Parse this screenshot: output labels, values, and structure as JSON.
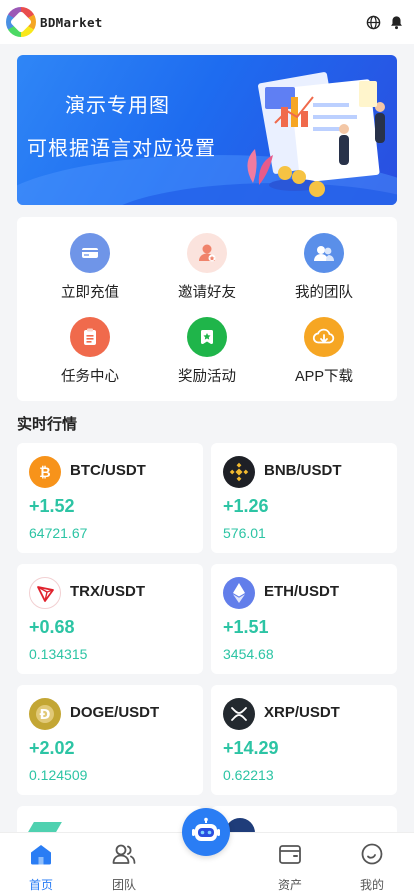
{
  "header": {
    "brand": "BDMarket",
    "icons": [
      "globe-icon",
      "bell-icon"
    ]
  },
  "banner": {
    "line1": "演示专用图",
    "line2": "可根据语言对应设置"
  },
  "shortcuts": [
    {
      "label": "立即充值",
      "icon": "recharge-icon",
      "color": "#6f95e8"
    },
    {
      "label": "邀请好友",
      "icon": "invite-icon",
      "color": "#f0836b"
    },
    {
      "label": "我的团队",
      "icon": "team-icon",
      "color": "#5a8fe9"
    },
    {
      "label": "任务中心",
      "icon": "task-icon",
      "color": "#f06a4c"
    },
    {
      "label": "奖励活动",
      "icon": "reward-icon",
      "color": "#1fb54a"
    },
    {
      "label": "APP下载",
      "icon": "download-icon",
      "color": "#f6a623"
    }
  ],
  "market": {
    "title": "实时行情",
    "items": [
      {
        "pair": "BTC/USDT",
        "change": "+1.52",
        "price": "64721.67",
        "icon": "btc-icon",
        "color": "#f7931a"
      },
      {
        "pair": "BNB/USDT",
        "change": "+1.26",
        "price": "576.01",
        "icon": "bnb-icon",
        "color": "#f3ba2f"
      },
      {
        "pair": "TRX/USDT",
        "change": "+0.68",
        "price": "0.134315",
        "icon": "trx-icon",
        "color": "#e0222d"
      },
      {
        "pair": "ETH/USDT",
        "change": "+1.51",
        "price": "3454.68",
        "icon": "eth-icon",
        "color": "#627eea"
      },
      {
        "pair": "DOGE/USDT",
        "change": "+2.02",
        "price": "0.124509",
        "icon": "doge-icon",
        "color": "#c3a634"
      },
      {
        "pair": "XRP/USDT",
        "change": "+14.29",
        "price": "0.62213",
        "icon": "xrp-icon",
        "color": "#23292f"
      }
    ],
    "accent": "#2cc4a4"
  },
  "tabbar": {
    "items": [
      {
        "label": "首页",
        "icon": "home-icon",
        "active": true
      },
      {
        "label": "团队",
        "icon": "team-icon"
      },
      {
        "label": "资产",
        "icon": "wallet-icon"
      },
      {
        "label": "我的",
        "icon": "profile-icon"
      }
    ],
    "center_icon": "robot-icon",
    "active_color": "#2a7df4"
  }
}
